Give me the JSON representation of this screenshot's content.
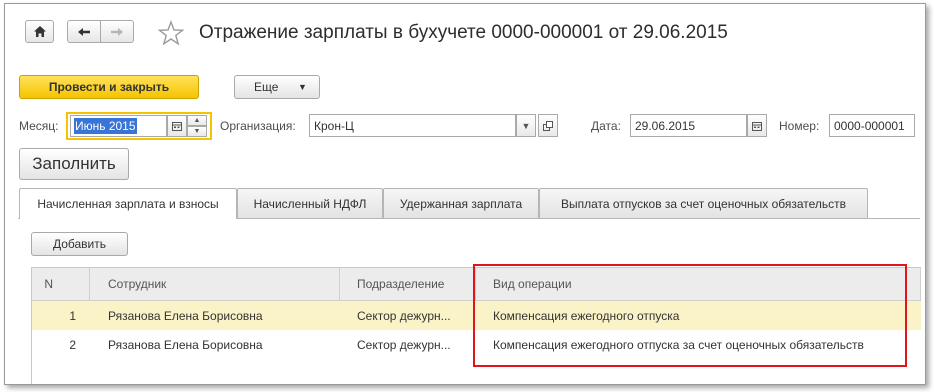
{
  "header": {
    "title": "Отражение зарплаты в бухучете 0000-000001 от 29.06.2015",
    "home_icon": "home-icon",
    "back_icon": "arrow-left-icon",
    "forward_icon": "arrow-right-icon",
    "star_icon": "star-icon"
  },
  "toolbar": {
    "post_close_label": "Провести и закрыть",
    "more_label": "Еще"
  },
  "form": {
    "month_label": "Месяц:",
    "month_value": "Июнь 2015",
    "org_label": "Организация:",
    "org_value": "Крон-Ц",
    "date_label": "Дата:",
    "date_value": "29.06.2015",
    "number_label": "Номер:",
    "number_value": "0000-000001"
  },
  "fill_button_label": "Заполнить",
  "tabs": [
    {
      "label": "Начисленная зарплата и взносы",
      "active": true
    },
    {
      "label": "Начисленный НДФЛ",
      "active": false
    },
    {
      "label": "Удержанная зарплата",
      "active": false
    },
    {
      "label": "Выплата отпусков за счет оценочных обязательств",
      "active": false
    }
  ],
  "add_button_label": "Добавить",
  "table": {
    "columns": [
      "N",
      "Сотрудник",
      "Подразделение",
      "Вид операции"
    ],
    "rows": [
      {
        "n": "1",
        "employee": "Рязанова Елена Борисовна",
        "department": "Сектор дежурн...",
        "operation": "Компенсация ежегодного отпуска",
        "selected": true
      },
      {
        "n": "2",
        "employee": "Рязанова Елена Борисовна",
        "department": "Сектор дежурн...",
        "operation": "Компенсация ежегодного отпуска за счет оценочных обязательств",
        "selected": false
      }
    ]
  },
  "colors": {
    "primary_button": "#f5c400",
    "selected_row": "#fbf3c8",
    "highlight_box": "#e0141b"
  }
}
